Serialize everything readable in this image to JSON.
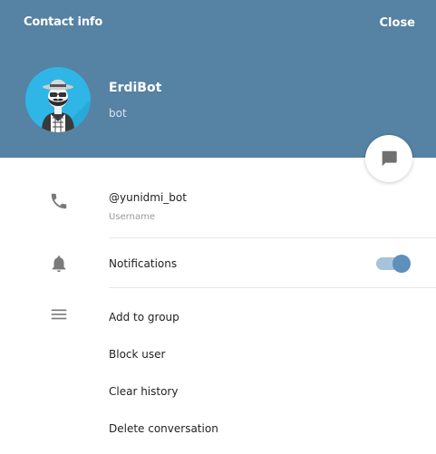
{
  "header": {
    "title": "Contact info",
    "close_label": "Close",
    "background_color": "#5682a3"
  },
  "profile": {
    "name": "ErdiBot",
    "status": "bot",
    "avatar_icon": "hipster-bot-avatar"
  },
  "fab": {
    "icon": "message-icon"
  },
  "info": {
    "username_value": "@yunidmi_bot",
    "username_label": "Username",
    "icon": "phone-icon"
  },
  "notifications": {
    "label": "Notifications",
    "enabled": true,
    "icon": "bell-icon",
    "accent_color": "#5e8fbd"
  },
  "actions": {
    "icon": "menu-icon",
    "items": [
      "Add to group",
      "Block user",
      "Clear history",
      "Delete conversation"
    ]
  }
}
